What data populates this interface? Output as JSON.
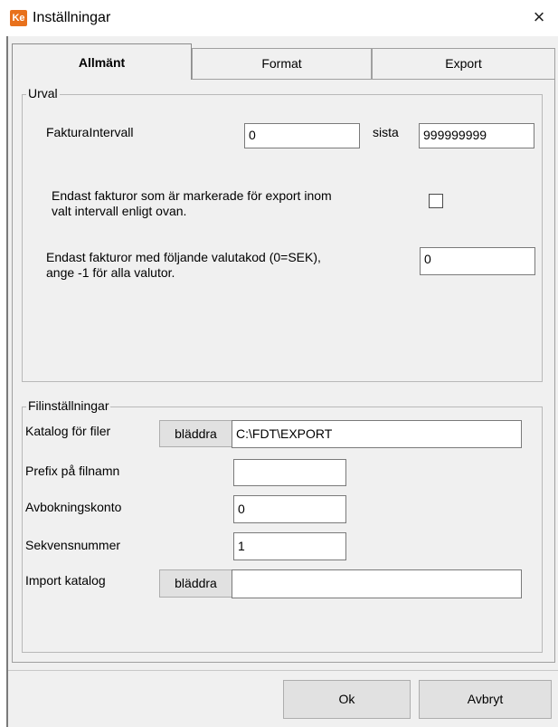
{
  "window": {
    "logo": "Ke",
    "title": "Inställningar",
    "close_glyph": "×"
  },
  "tabs": [
    {
      "label": "Allmänt",
      "active": true
    },
    {
      "label": "Format",
      "active": false
    },
    {
      "label": "Export",
      "active": false
    }
  ],
  "urval": {
    "legend": "Urval",
    "faktura_label": "FakturaIntervall",
    "from_value": "0",
    "sista_label": "sista",
    "to_value": "999999999",
    "endast_export_line1": "Endast fakturor som är markerade för export inom",
    "endast_export_line2": "valt intervall enligt ovan.",
    "endast_export_checked": false,
    "valuta_line1": "Endast fakturor med följande valutakod (0=SEK),",
    "valuta_line2": "ange -1 för alla valutor.",
    "valuta_value": "0"
  },
  "fil": {
    "legend": "Filinställningar",
    "katalog_label": "Katalog för filer",
    "katalog_browse": "bläddra",
    "katalog_value": "C:\\FDT\\EXPORT",
    "prefix_label": "Prefix på filnamn",
    "prefix_value": "",
    "avbokning_label": "Avbokningskonto",
    "avbokning_value": "0",
    "sekvens_label": "Sekvensnummer",
    "sekvens_value": "1",
    "import_label": "Import katalog",
    "import_browse": "bläddra",
    "import_value": ""
  },
  "buttons": {
    "ok": "Ok",
    "cancel": "Avbryt"
  },
  "colors": {
    "dialog_bg": "#f0f0f0",
    "logo_bg": "#e8711c",
    "border": "#a0a0a0"
  }
}
